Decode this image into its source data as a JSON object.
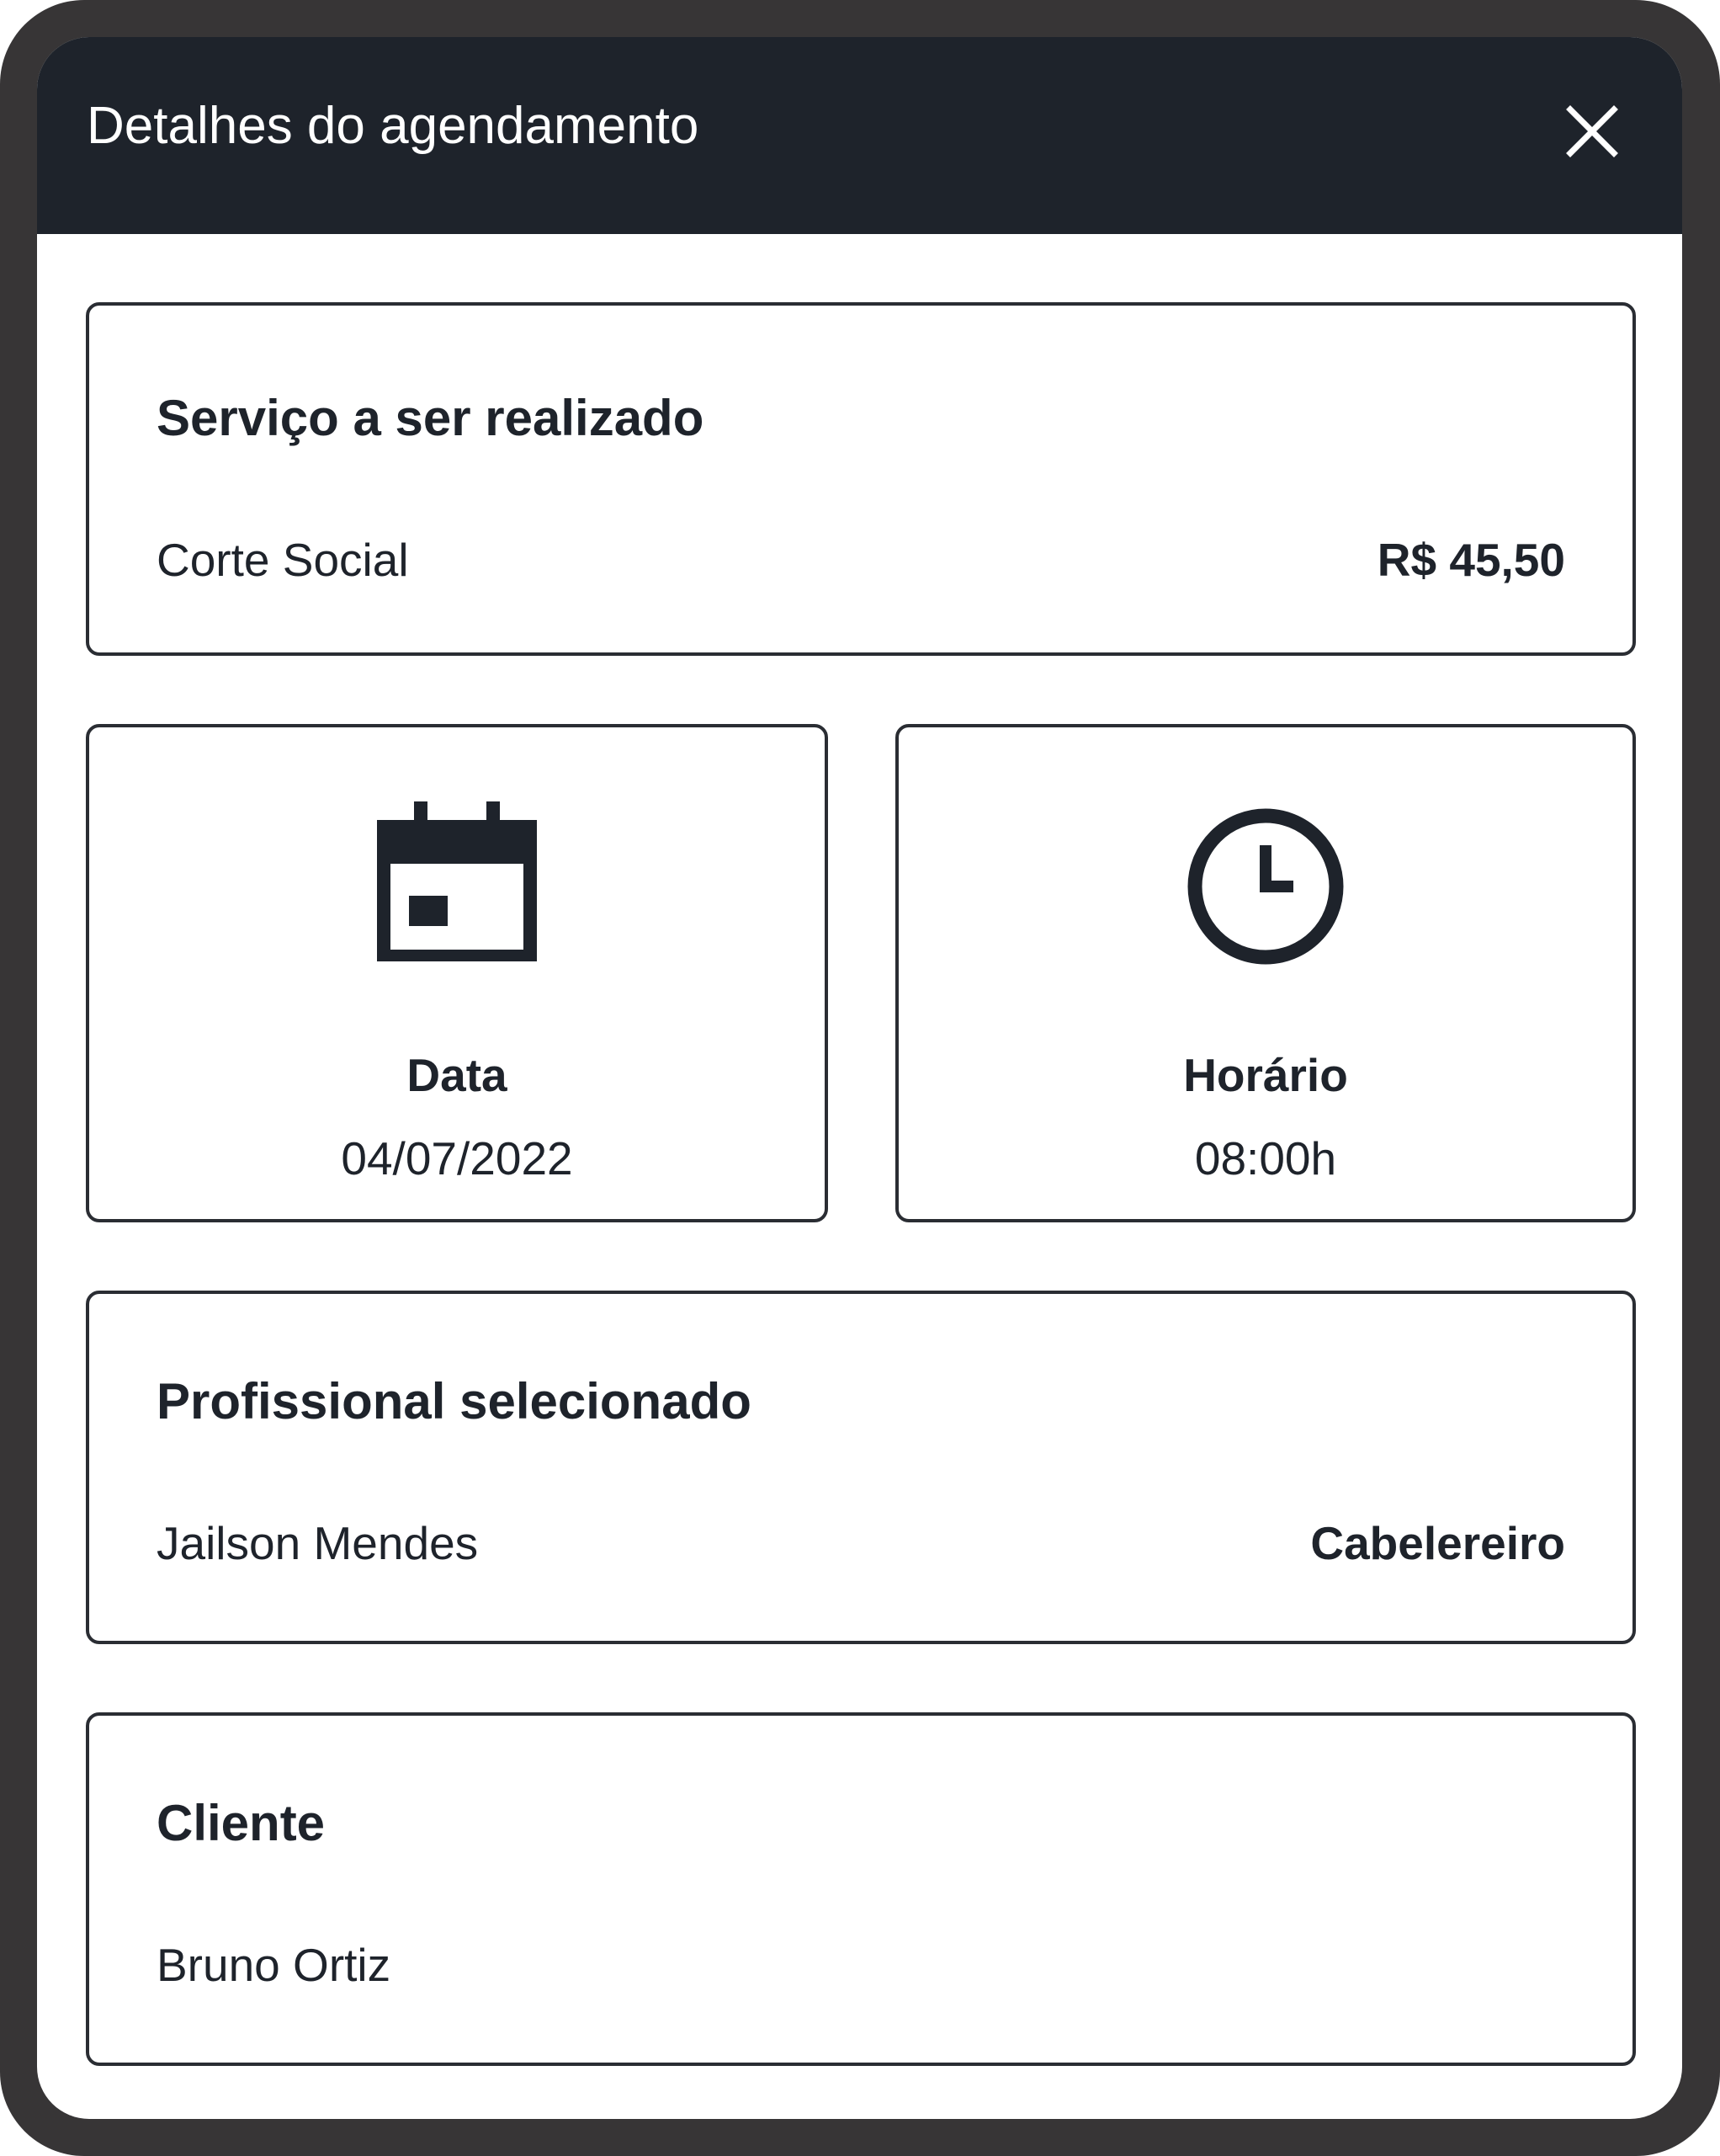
{
  "colors": {
    "header_bg": "#1e232b",
    "frame": "#373536",
    "text": "#1e232b",
    "border": "#2a2d33"
  },
  "header": {
    "title": "Detalhes do agendamento",
    "close_icon": "close-icon"
  },
  "service": {
    "title": "Serviço a ser realizado",
    "name": "Corte Social",
    "price": "R$ 45,50"
  },
  "date": {
    "icon": "calendar-icon",
    "label": "Data",
    "value": "04/07/2022"
  },
  "time": {
    "icon": "clock-icon",
    "label": "Horário",
    "value": "08:00h"
  },
  "professional": {
    "title": "Profissional selecionado",
    "name": "Jailson Mendes",
    "role": "Cabelereiro"
  },
  "client": {
    "title": "Cliente",
    "name": "Bruno Ortiz"
  }
}
